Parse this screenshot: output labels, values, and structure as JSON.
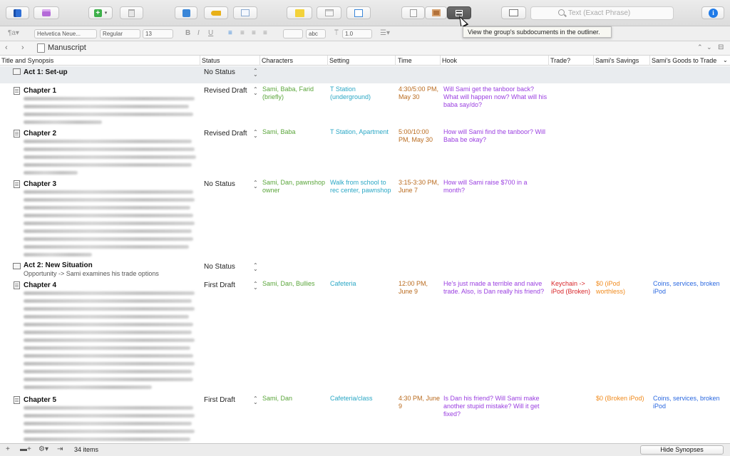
{
  "colors": {
    "accent": "#1e7ae8",
    "characters": "#5aa53a",
    "setting": "#2aa7c5",
    "time": "#b96a1d",
    "hook": "#9a3ee0",
    "trade": "#d8262a",
    "savings": "#f08a1c",
    "goods": "#2a68e0"
  },
  "toolbar": {
    "search_placeholder": "Text (Exact Phrase)",
    "tooltip": "View the group's subdocuments in the outliner.",
    "icons": [
      "binder-icon",
      "collections-icon",
      "add-icon",
      "trash-icon",
      "fullscreen-icon",
      "keywords-icon",
      "edit-icon",
      "note-icon",
      "scrivenings-icon",
      "compile-icon",
      "single-view-icon",
      "corkboard-icon",
      "outliner-icon",
      "quick-search-icon",
      "inspector-icon"
    ]
  },
  "formatbar": {
    "font_family": "Helvetica Neue...",
    "font_style": "Regular",
    "font_size": "13",
    "text_color_label": "abc",
    "line_spacing": "1.0",
    "bold": "B",
    "italic": "I",
    "underline": "U"
  },
  "nav": {
    "title": "Manuscript"
  },
  "columns": [
    "Title and Synopsis",
    "Status",
    "Characters",
    "Setting",
    "Time",
    "Hook",
    "Trade?",
    "Sami's Savings",
    "Sami's Goods to Trade"
  ],
  "rows": [
    {
      "title": "Act 1: Set-up",
      "status": "No Status"
    },
    {
      "title": "Chapter 1",
      "status": "Revised Draft",
      "characters": "Sami, Baba, Farid (briefly)",
      "setting": "T Station (underground)",
      "time": "4:30/5:00 PM, May 30",
      "hook": "Will Sami get the tanboor back? What will happen now? What will his baba say/do?"
    },
    {
      "title": "Chapter 2",
      "status": "Revised Draft",
      "characters": "Sami, Baba",
      "setting": "T Station, Apartment",
      "time": "5:00/10:00 PM, May 30",
      "hook": "How will Sami find the tanboor? Will Baba be okay?"
    },
    {
      "title": "Chapter 3",
      "status": "No Status",
      "characters": "Sami, Dan, pawnshop owner",
      "setting": "Walk from school to rec center, pawnshop",
      "time": "3:15-3:30 PM, June 7",
      "hook": "How will Sami raise $700 in a month?"
    },
    {
      "title": "Act 2: New Situation",
      "synopsis": "Opportunity -> Sami examines his trade options",
      "status": "No Status"
    },
    {
      "title": "Chapter 4",
      "status": "First Draft",
      "characters": "Sami, Dan, Bullies",
      "setting": "Cafeteria",
      "time": "12:00 PM, June 9",
      "hook": "He's just made a terrible and naive trade. Also, is Dan really his friend?",
      "trade": "Keychain -> iPod (Broken)",
      "savings": "$0 (iPod worthless)",
      "goods": "Coins, services, broken iPod"
    },
    {
      "title": "Chapter 5",
      "status": "First Draft",
      "characters": "Sami, Dan",
      "setting": "Cafeteria/class",
      "time": "4:30 PM, June 9",
      "hook": "Is Dan his friend? Will Sami make another stupid mistake? Will it get fixed?",
      "savings": "$0 (Broken iPod)",
      "goods": "Coins, services, broken iPod"
    }
  ],
  "footer": {
    "count": "34 items",
    "hide_synopses": "Hide Synopses"
  }
}
